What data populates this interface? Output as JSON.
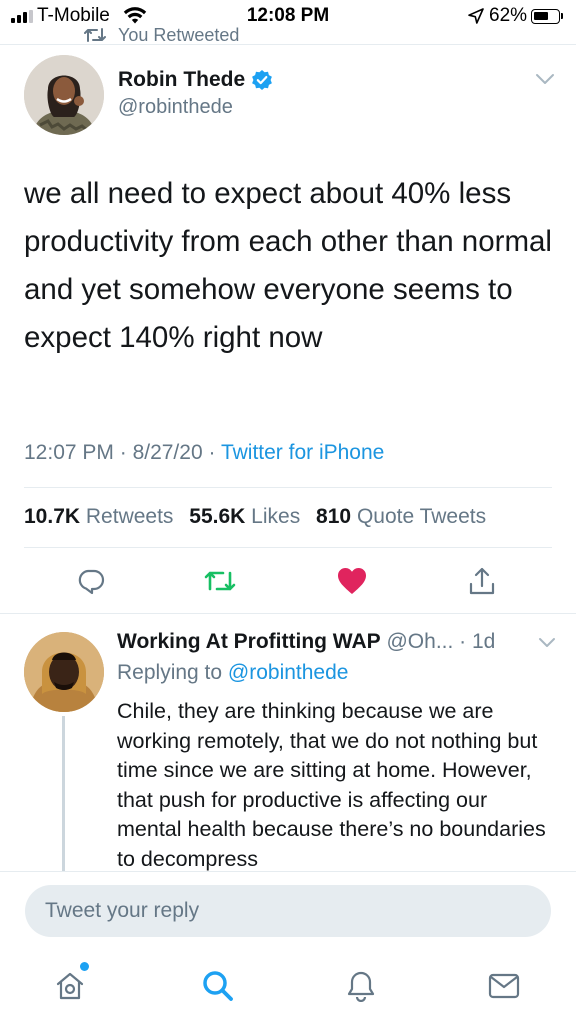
{
  "status_bar": {
    "carrier": "T-Mobile",
    "time": "12:08 PM",
    "battery": "62%",
    "battery_level": 0.62,
    "signal_bars": 3,
    "icons": [
      "signal-icon",
      "wifi-icon",
      "location-icon",
      "battery-icon"
    ]
  },
  "retweet_header": "You Retweeted",
  "tweet": {
    "author_name": "Robin Thede",
    "author_handle": "@robinthede",
    "verified": true,
    "text": "we all need to expect about 40% less productivity from each other than normal and yet somehow everyone seems to expect 140% right now",
    "time": "12:07 PM",
    "date": "8/27/20",
    "source": "Twitter for iPhone",
    "stats": {
      "retweets_count": "10.7K",
      "retweets_label": "Retweets",
      "likes_count": "55.6K",
      "likes_label": "Likes",
      "quotes_count": "810",
      "quotes_label": "Quote Tweets"
    },
    "retweeted": true,
    "liked": true,
    "action_icons": [
      "reply-icon",
      "retweet-icon",
      "like-icon",
      "share-icon"
    ]
  },
  "reply": {
    "name": "Working At Profitting WAP",
    "handle": "@Oh...",
    "age": "1d",
    "replying_prefix": "Replying to",
    "replying_to": "@robinthede",
    "text": "Chile, they are thinking because we are working remotely, that we do not nothing but time since we are sitting at home. However, that push for productive is affecting our mental health because there’s no boundaries to decompress"
  },
  "composer": {
    "placeholder": "Tweet your reply"
  },
  "tab_bar": {
    "items": [
      "home-icon",
      "search-icon",
      "notifications-icon",
      "messages-icon"
    ],
    "home_has_new": true
  },
  "colors": {
    "accent": "#1da1f2",
    "link": "#1b95e0",
    "retweet_green": "#17bf63",
    "like_red": "#e0245e",
    "muted_text": "#657786",
    "divider": "#e6ecf0"
  }
}
